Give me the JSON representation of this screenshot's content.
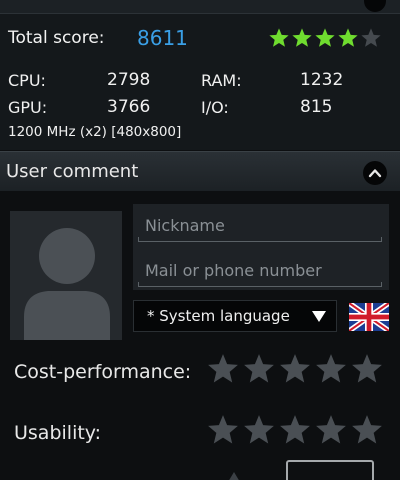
{
  "score": {
    "label": "Total score:",
    "value": "8611",
    "value_color": "#3a9fe6",
    "star_rating": 4,
    "star_max": 5,
    "star_color": "#6fdc2f"
  },
  "specs": [
    {
      "label": "CPU:",
      "value": "2798"
    },
    {
      "label": "RAM:",
      "value": "1232"
    },
    {
      "label": "GPU:",
      "value": "3766"
    },
    {
      "label": "I/O:",
      "value": "815"
    }
  ],
  "clock_line": "1200 MHz (x2) [480x800]",
  "comment": {
    "title": "User comment",
    "toggle_icon": "chevron-up-icon",
    "nickname_placeholder": "Nickname",
    "contact_placeholder": "Mail or phone number",
    "language": "* System language",
    "flag_icon": "uk-flag-icon"
  },
  "ratings": [
    {
      "label": "Cost-performance:",
      "value": 0,
      "max": 5
    },
    {
      "label": "Usability:",
      "value": 0,
      "max": 5
    }
  ]
}
